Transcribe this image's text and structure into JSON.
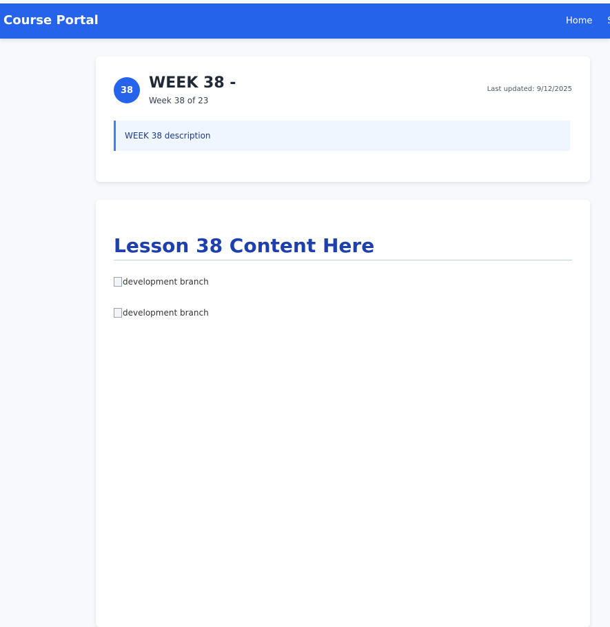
{
  "navbar": {
    "brand": "Course Portal",
    "links": [
      "Home",
      "S"
    ]
  },
  "week_card": {
    "badge": "38",
    "title": "WEEK 38 -",
    "subtitle": "Week 38 of 23",
    "updated_label": "Last updated:",
    "updated_date": "9/12/2025",
    "description": "WEEK 38 description"
  },
  "content": {
    "heading": "Lesson 38 Content Here",
    "images": [
      {
        "alt": "development branch"
      },
      {
        "alt": "development branch"
      }
    ]
  },
  "colors": {
    "primary": "#2563eb",
    "heading": "#1e40af",
    "page_bg": "#f7f9fc"
  }
}
